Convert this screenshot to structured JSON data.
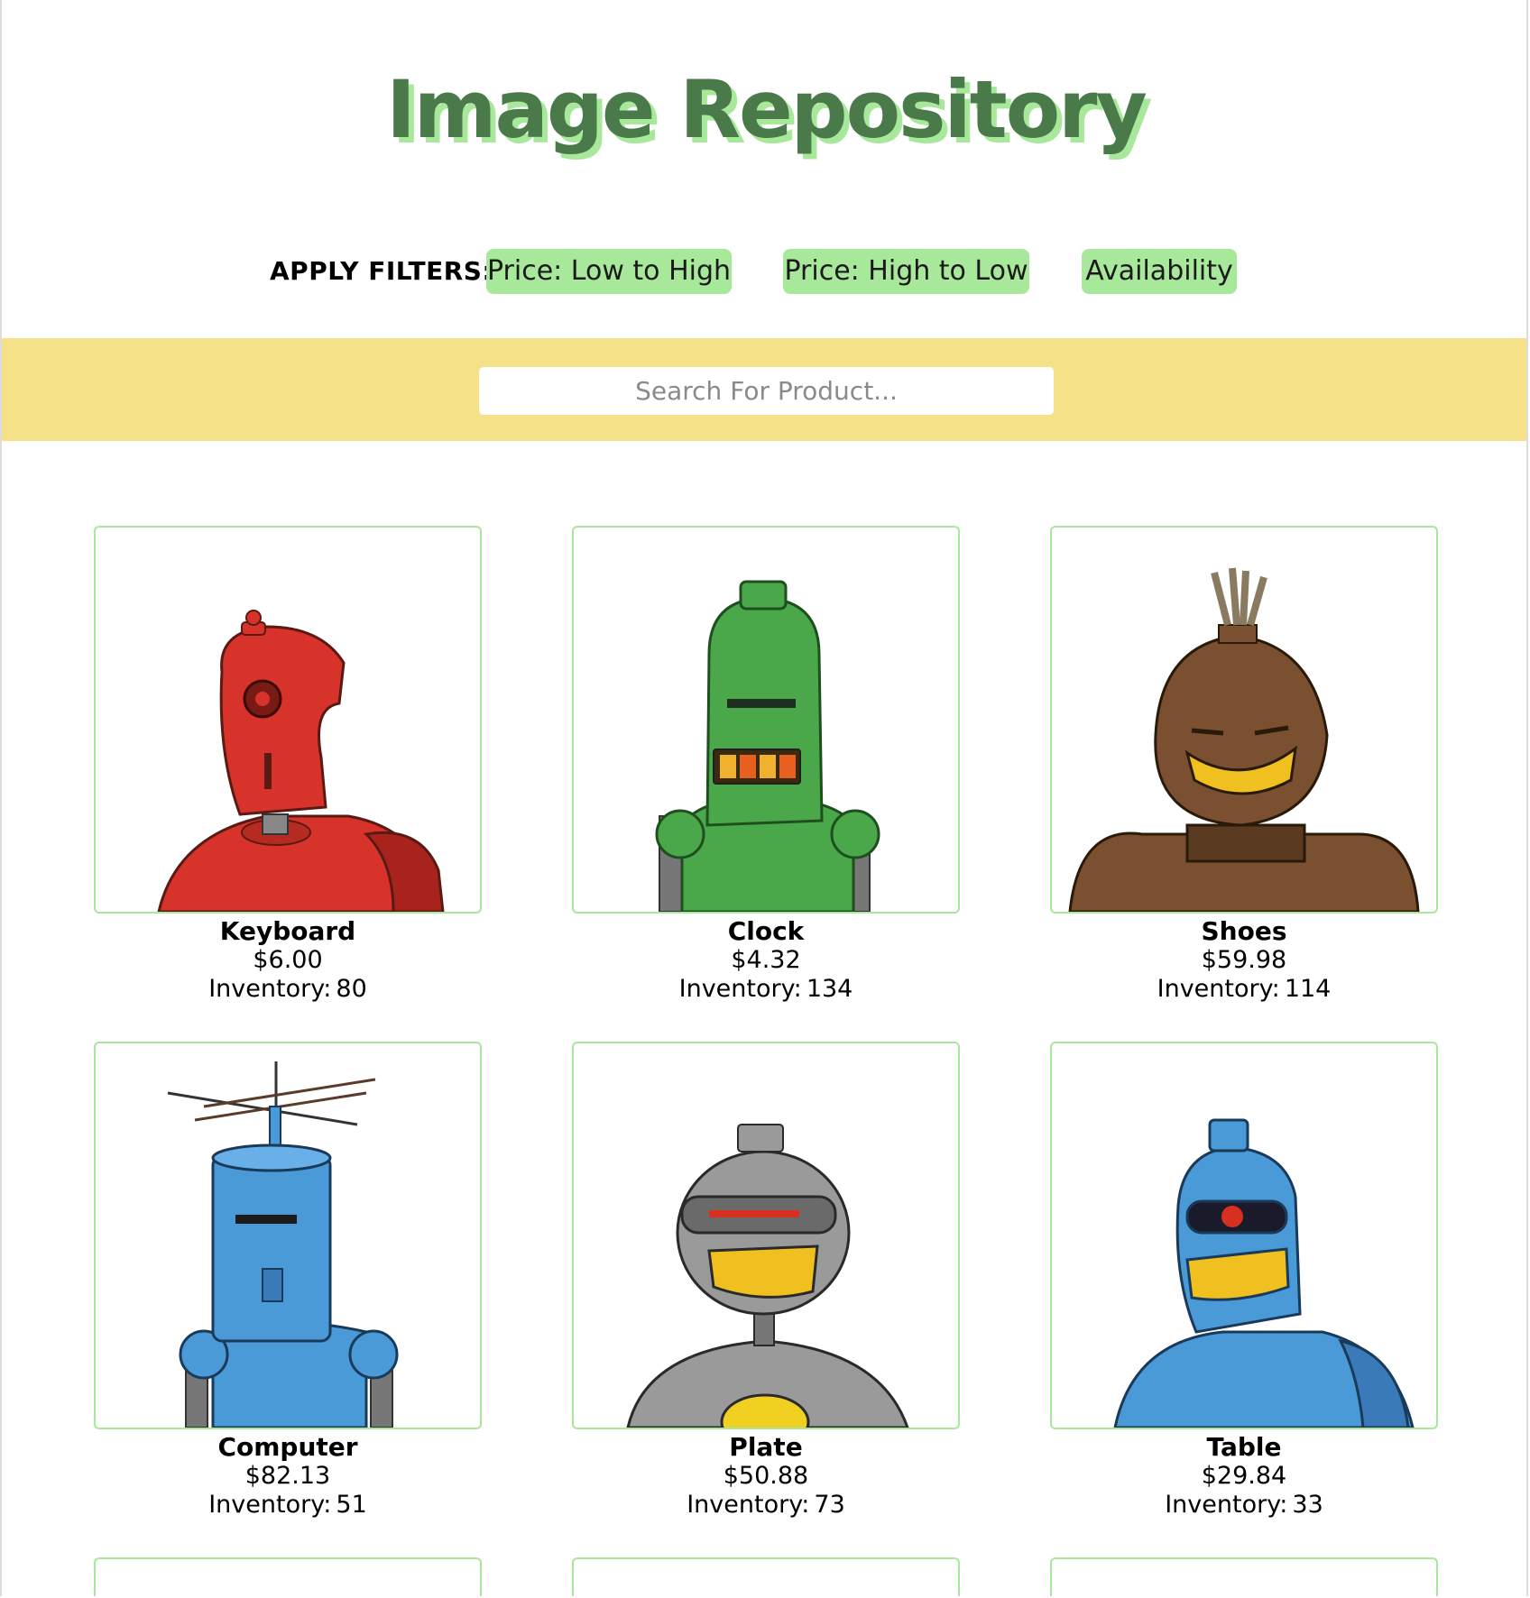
{
  "page": {
    "title": "Image Repository"
  },
  "filters": {
    "label": "APPLY FILTERS:",
    "buttons": [
      "Price: Low to High",
      "Price: High to Low",
      "Availability"
    ]
  },
  "search": {
    "placeholder": "Search For Product..."
  },
  "colors": {
    "accent_green": "#a8e89a",
    "title_green": "#4a7a4a",
    "search_band": "#f4e188"
  },
  "products": [
    {
      "name": "Keyboard",
      "price": "$6.00",
      "inventory_label": "Inventory:",
      "inventory": "80",
      "image": "red-robot-image"
    },
    {
      "name": "Clock",
      "price": "$4.32",
      "inventory_label": "Inventory:",
      "inventory": "134",
      "image": "green-robot-image"
    },
    {
      "name": "Shoes",
      "price": "$59.98",
      "inventory_label": "Inventory:",
      "inventory": "114",
      "image": "brown-robot-image"
    },
    {
      "name": "Computer",
      "price": "$82.13",
      "inventory_label": "Inventory:",
      "inventory": "51",
      "image": "blue-antenna-robot-image"
    },
    {
      "name": "Plate",
      "price": "$50.88",
      "inventory_label": "Inventory:",
      "inventory": "73",
      "image": "grey-robot-image"
    },
    {
      "name": "Table",
      "price": "$29.84",
      "inventory_label": "Inventory:",
      "inventory": "33",
      "image": "blue-cyclops-robot-image"
    }
  ]
}
